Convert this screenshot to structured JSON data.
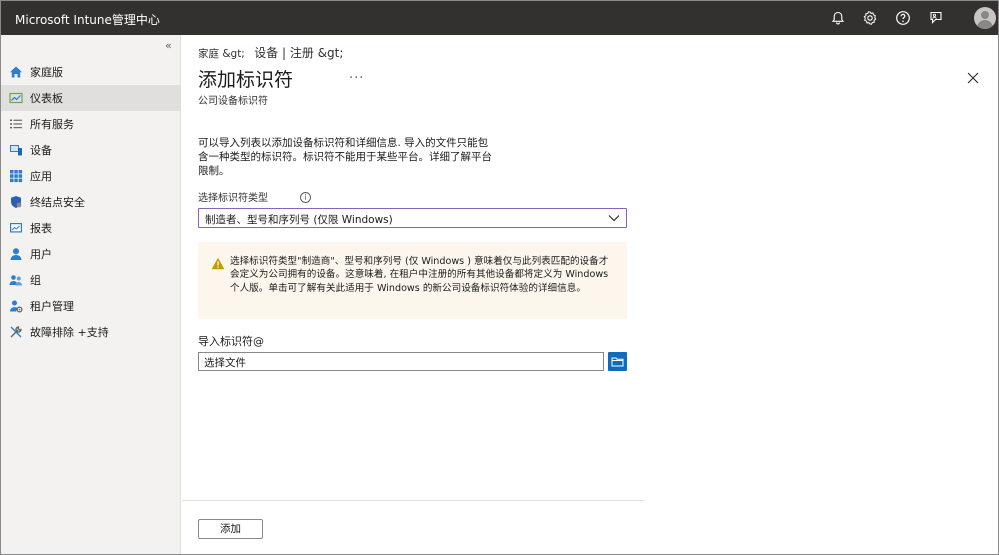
{
  "app": {
    "title": "Microsoft Intune管理中心"
  },
  "topbar": {
    "icons": [
      "bell-icon",
      "gear-icon",
      "help-icon",
      "feedback-icon",
      "avatar"
    ],
    "accent": "#323130"
  },
  "sidebar": {
    "collapse_label": "«",
    "items": [
      {
        "label": "家庭版",
        "icon": "home-icon",
        "active": false
      },
      {
        "label": "仪表板",
        "icon": "dashboard-icon",
        "active": true
      },
      {
        "label": "所有服务",
        "icon": "list-icon",
        "active": false
      },
      {
        "label": "设备",
        "icon": "devices-icon",
        "active": false
      },
      {
        "label": "应用",
        "icon": "apps-icon",
        "active": false
      },
      {
        "label": "终结点安全",
        "icon": "shield-icon",
        "active": false
      },
      {
        "label": "报表",
        "icon": "reports-icon",
        "active": false
      },
      {
        "label": "用户",
        "icon": "user-icon",
        "active": false
      },
      {
        "label": "组",
        "icon": "group-icon",
        "active": false
      },
      {
        "label": "租户管理",
        "icon": "tenant-icon",
        "active": false
      },
      {
        "label": "故障排除 +支持",
        "icon": "tools-icon",
        "active": false
      }
    ]
  },
  "main": {
    "breadcrumb": [
      "家庭 &gt;",
      "设备 | 注册 &gt;"
    ],
    "title": "添加标识符",
    "more_label": "...",
    "subtitle": "公司设备标识符",
    "description": "可以导入列表以添加设备标识符和详细信息. 导入的文件只能包含一种类型的标识符。标识符不能用于某些平台。详细了解平台限制。",
    "identifier_type_label": "选择标识符类型",
    "info_glyph": "i",
    "identifier_type_value": "制造者、型号和序列号 (仅限 Windows)",
    "warning": "选择标识符类型\"制造商\"、型号和序列号 (仅 Windows ) 意味着仅与此列表匹配的设备才会定义为公司拥有的设备。这意味着, 在租户中注册的所有其他设备都将定义为 Windows 个人版。单击可了解有关此适用于 Windows 的新公司设备标识符体验的详细信息。",
    "import_label": "导入标识符@",
    "file_placeholder": "选择文件",
    "add_button": "添加"
  },
  "colors": {
    "select_border": "#8764b8",
    "warning_bg": "#fdf6ed",
    "warning_icon": "#c19c00",
    "file_button": "#0f6cbd"
  }
}
